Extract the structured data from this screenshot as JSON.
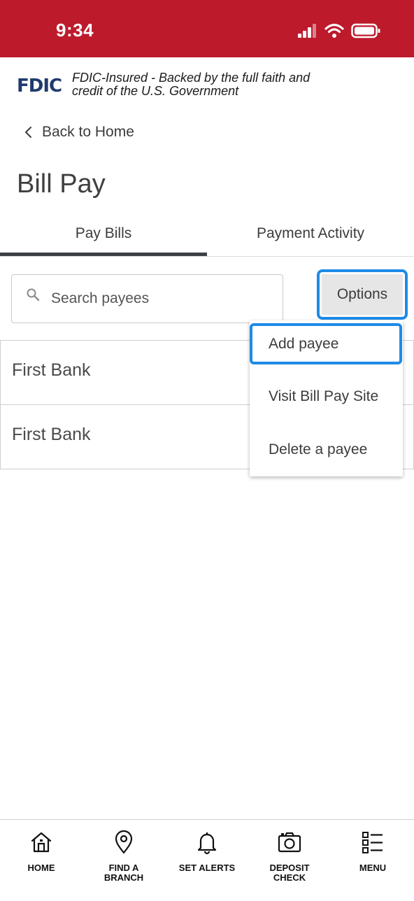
{
  "status_bar": {
    "time": "9:34",
    "icons": [
      "cellular-signal-icon",
      "wifi-icon",
      "battery-icon"
    ],
    "background_color": "#bd1a2c"
  },
  "fdic": {
    "logo_text": "FDIC",
    "notice_line1": "FDIC-Insured - Backed by the full faith and",
    "notice_line2": "credit of the U.S. Government"
  },
  "back": {
    "label": "Back to Home",
    "icon": "chevron-left-icon"
  },
  "page": {
    "title": "Bill Pay"
  },
  "tabs": [
    {
      "label": "Pay Bills",
      "active": true
    },
    {
      "label": "Payment Activity",
      "active": false
    }
  ],
  "search": {
    "placeholder": "Search payees",
    "value": "",
    "icon": "search-icon"
  },
  "options": {
    "label": "Options",
    "highlight_color": "#1e8be6"
  },
  "payees": [
    {
      "name": "First Bank"
    },
    {
      "name": "First Bank"
    }
  ],
  "options_menu": {
    "items": [
      {
        "label": "Add payee",
        "highlighted": true
      },
      {
        "label": "Visit Bill Pay Site",
        "highlighted": false
      },
      {
        "label": "Delete a payee",
        "highlighted": false
      }
    ]
  },
  "bottom_nav": {
    "items": [
      {
        "label": "HOME",
        "icon": "home-icon"
      },
      {
        "label": "FIND A\nBRANCH",
        "icon": "map-pin-icon"
      },
      {
        "label": "SET ALERTS",
        "icon": "bell-icon"
      },
      {
        "label": "DEPOSIT\nCHECK",
        "icon": "camera-icon"
      },
      {
        "label": "MENU",
        "icon": "menu-list-icon"
      }
    ]
  }
}
